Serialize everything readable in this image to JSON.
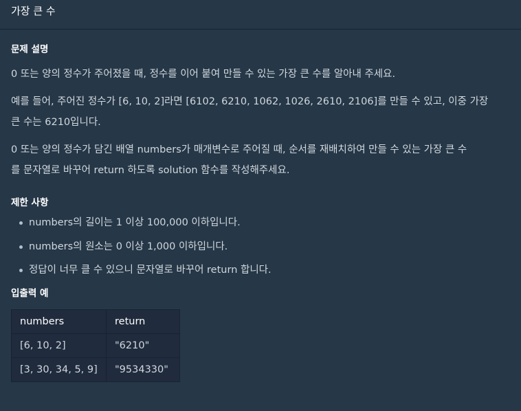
{
  "header": {
    "title": "가장 큰 수"
  },
  "description": {
    "title": "문제 설명",
    "p1": "0 또는 양의 정수가 주어졌을 때, 정수를 이어 붙여 만들 수 있는 가장 큰 수를 알아내 주세요.",
    "p2_line1": "예를 들어, 주어진 정수가 [6, 10, 2]라면 [6102, 6210, 1062, 1026, 2610, 2106]를 만들 수 있고, 이중 가장",
    "p2_line2": "큰 수는 6210입니다.",
    "p3_line1": "0 또는 양의 정수가 담긴 배열 numbers가 매개변수로 주어질 때, 순서를 재배치하여 만들 수 있는 가장 큰 수",
    "p3_line2": "를 문자열로 바꾸어 return 하도록 solution 함수를 작성해주세요."
  },
  "limits": {
    "title": "제한 사항",
    "items": [
      "numbers의 길이는 1 이상 100,000 이하입니다.",
      "numbers의 원소는 0 이상 1,000 이하입니다.",
      "정답이 너무 클 수 있으니 문자열로 바꾸어 return 합니다."
    ]
  },
  "examples": {
    "title": "입출력 예",
    "headers": [
      "numbers",
      "return"
    ],
    "rows": [
      [
        "[6, 10, 2]",
        "\"6210\""
      ],
      [
        "[3, 30, 34, 5, 9]",
        "\"9534330\""
      ]
    ]
  }
}
